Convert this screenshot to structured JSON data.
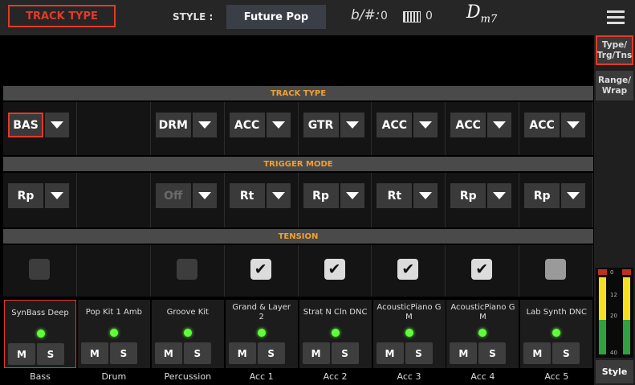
{
  "header": {
    "page_title": "TRACK TYPE",
    "style_label": "STYLE :",
    "style_name": "Future Pop",
    "transpose_icon": "b/#:",
    "transpose_value": "0",
    "octave_icon": "keyboard-icon",
    "octave_value": "0",
    "chord": "D m7",
    "menu_icon": "menu-icon"
  },
  "sidebar": {
    "tabs": [
      {
        "label": "Type/ Trg/Tns",
        "active": true
      },
      {
        "label": "Range/ Wrap",
        "active": false
      }
    ],
    "meter_labels": [
      "0",
      "12",
      "20",
      "40"
    ],
    "style_button": "Style"
  },
  "sections": {
    "track_type": "TRACK TYPE",
    "trigger_mode": "TRIGGER MODE",
    "tension": "TENSION"
  },
  "tracks": [
    {
      "type": "BAS",
      "trigger": "Rp",
      "trigger_enabled": true,
      "tension": false,
      "tension_active": false,
      "sound": "SynBass Deep",
      "name": "Bass",
      "mute": "M",
      "solo": "S",
      "selected": true
    },
    {
      "type": "",
      "trigger": "",
      "trigger_enabled": false,
      "tension": null,
      "tension_active": false,
      "sound": "Pop Kit 1 Amb",
      "name": "Drum",
      "mute": "M",
      "solo": "S",
      "selected": false
    },
    {
      "type": "DRM",
      "trigger": "Off",
      "trigger_enabled": false,
      "tension": false,
      "tension_active": false,
      "sound": "Groove Kit",
      "name": "Percussion",
      "mute": "M",
      "solo": "S",
      "selected": false
    },
    {
      "type": "ACC",
      "trigger": "Rt",
      "trigger_enabled": true,
      "tension": true,
      "tension_active": true,
      "sound": "Grand & Layer 2",
      "name": "Acc 1",
      "mute": "M",
      "solo": "S",
      "selected": false
    },
    {
      "type": "GTR",
      "trigger": "Rp",
      "trigger_enabled": true,
      "tension": true,
      "tension_active": true,
      "sound": "Strat N Cln DNC",
      "name": "Acc 2",
      "mute": "M",
      "solo": "S",
      "selected": false
    },
    {
      "type": "ACC",
      "trigger": "Rt",
      "trigger_enabled": true,
      "tension": true,
      "tension_active": true,
      "sound": "AcousticPiano GM",
      "name": "Acc 3",
      "mute": "M",
      "solo": "S",
      "selected": false
    },
    {
      "type": "ACC",
      "trigger": "Rp",
      "trigger_enabled": true,
      "tension": true,
      "tension_active": true,
      "sound": "AcousticPiano GM",
      "name": "Acc 4",
      "mute": "M",
      "solo": "S",
      "selected": false
    },
    {
      "type": "ACC",
      "trigger": "Rp",
      "trigger_enabled": true,
      "tension": false,
      "tension_active": true,
      "sound": "Lab Synth DNC",
      "name": "Acc 5",
      "mute": "M",
      "solo": "S",
      "selected": false
    }
  ],
  "colors": {
    "accent": "#e23a2a",
    "section_header_text": "#f0a030",
    "led_on": "#5fff3a"
  }
}
